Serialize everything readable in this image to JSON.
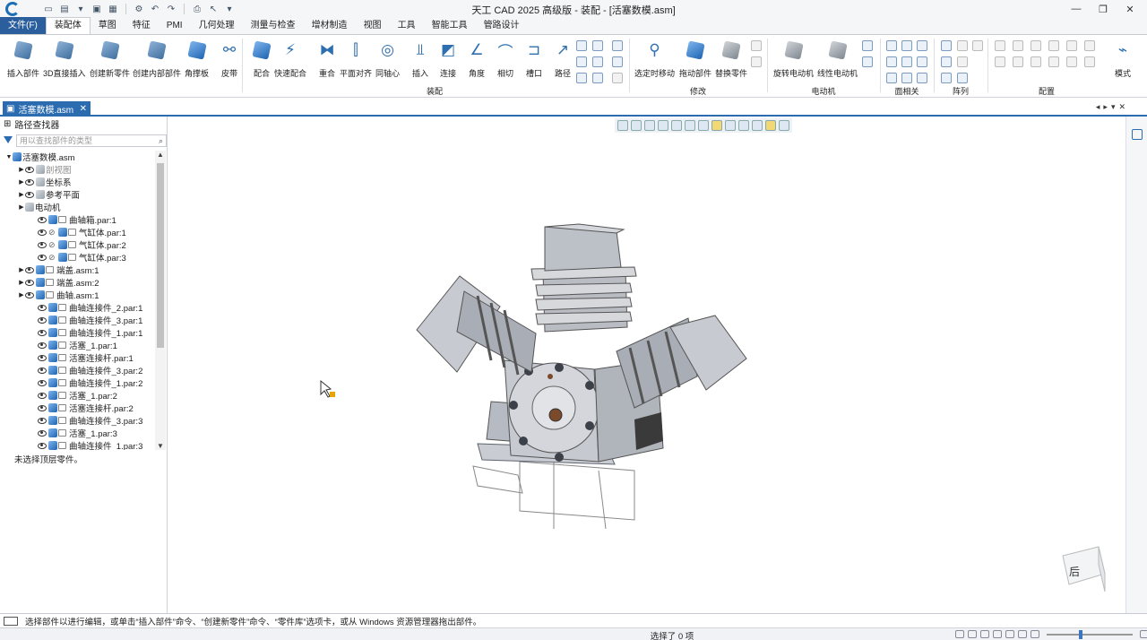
{
  "window": {
    "title": "天工 CAD 2025 高级版 - 装配 - [活塞数模.asm]"
  },
  "menu_tabs": [
    "文件(F)",
    "装配体",
    "草图",
    "特征",
    "PMI",
    "几何处理",
    "测量与检查",
    "增材制造",
    "视图",
    "工具",
    "智能工具",
    "管路设计"
  ],
  "ribbon": {
    "buttons": [
      "插入部件",
      "3D直接插入",
      "创建新零件",
      "创建内部部件",
      "角撑板",
      "皮带",
      "配合",
      "快速配合",
      "重合",
      "平面对齐",
      "同轴心",
      "插入",
      "连接",
      "角度",
      "相切",
      "槽口",
      "路径",
      "选定时移动",
      "拖动部件",
      "替换零件",
      "旋转电动机",
      "线性电动机",
      "模式"
    ],
    "groups": [
      "装配",
      "修改",
      "电动机",
      "面相关",
      "阵列",
      "配置"
    ]
  },
  "document_tab": "活塞数模.asm",
  "panel": {
    "title": "路径查找器",
    "search_placeholder": "用以查找部件的类型",
    "tree": [
      {
        "label": "活塞数模.asm",
        "depth": 0,
        "expander": "open",
        "icon": "assembly",
        "eye": false,
        "link": false
      },
      {
        "label": "剖视图",
        "depth": 1,
        "expander": "closed",
        "icon": "section",
        "eye": true,
        "link": false,
        "dim": true
      },
      {
        "label": "坐标系",
        "depth": 1,
        "expander": "closed",
        "icon": "axis",
        "eye": true,
        "link": false
      },
      {
        "label": "参考平面",
        "depth": 1,
        "expander": "closed",
        "icon": "plane",
        "eye": true,
        "link": false
      },
      {
        "label": "电动机",
        "depth": 1,
        "expander": "closed",
        "icon": "motor",
        "eye": false,
        "link": false
      },
      {
        "label": "曲轴箱.par:1",
        "depth": 2,
        "expander": "none",
        "icon": "part",
        "eye": true,
        "link": false
      },
      {
        "label": "气缸体.par:1",
        "depth": 2,
        "expander": "none",
        "icon": "part",
        "eye": true,
        "link": true
      },
      {
        "label": "气缸体.par:2",
        "depth": 2,
        "expander": "none",
        "icon": "part",
        "eye": true,
        "link": true
      },
      {
        "label": "气缸体.par:3",
        "depth": 2,
        "expander": "none",
        "icon": "part",
        "eye": true,
        "link": true
      },
      {
        "label": "端盖.asm:1",
        "depth": 1,
        "expander": "closed",
        "icon": "assembly",
        "eye": true,
        "link": false
      },
      {
        "label": "端盖.asm:2",
        "depth": 1,
        "expander": "closed",
        "icon": "assembly",
        "eye": true,
        "link": false
      },
      {
        "label": "曲轴.asm:1",
        "depth": 1,
        "expander": "closed",
        "icon": "assembly",
        "eye": true,
        "link": false
      },
      {
        "label": "曲轴连接件_2.par:1",
        "depth": 2,
        "expander": "none",
        "icon": "part",
        "eye": true,
        "link": false
      },
      {
        "label": "曲轴连接件_3.par:1",
        "depth": 2,
        "expander": "none",
        "icon": "part",
        "eye": true,
        "link": false
      },
      {
        "label": "曲轴连接件_1.par:1",
        "depth": 2,
        "expander": "none",
        "icon": "part",
        "eye": true,
        "link": false
      },
      {
        "label": "活塞_1.par:1",
        "depth": 2,
        "expander": "none",
        "icon": "part",
        "eye": true,
        "link": false
      },
      {
        "label": "活塞连接杆.par:1",
        "depth": 2,
        "expander": "none",
        "icon": "part",
        "eye": true,
        "link": false
      },
      {
        "label": "曲轴连接件_3.par:2",
        "depth": 2,
        "expander": "none",
        "icon": "part",
        "eye": true,
        "link": false
      },
      {
        "label": "曲轴连接件_1.par:2",
        "depth": 2,
        "expander": "none",
        "icon": "part",
        "eye": true,
        "link": false
      },
      {
        "label": "活塞_1.par:2",
        "depth": 2,
        "expander": "none",
        "icon": "part",
        "eye": true,
        "link": false
      },
      {
        "label": "活塞连接杆.par:2",
        "depth": 2,
        "expander": "none",
        "icon": "part",
        "eye": true,
        "link": false
      },
      {
        "label": "曲轴连接件_3.par:3",
        "depth": 2,
        "expander": "none",
        "icon": "part",
        "eye": true,
        "link": false
      },
      {
        "label": "活塞_1.par:3",
        "depth": 2,
        "expander": "none",
        "icon": "part",
        "eye": true,
        "link": false
      },
      {
        "label": "曲轴连接件_1.par:3",
        "depth": 2,
        "expander": "none",
        "icon": "part",
        "eye": true,
        "link": false
      }
    ],
    "status": "未选择顶层零件。"
  },
  "viewcube_label": "后",
  "command_prompt": "选择部件以进行编辑，或单击“插入部件”命令、“创建新零件”命令、“零件库”选项卡，或从 Windows 资源管理器拖出部件。",
  "status_text": "选择了 0 项"
}
